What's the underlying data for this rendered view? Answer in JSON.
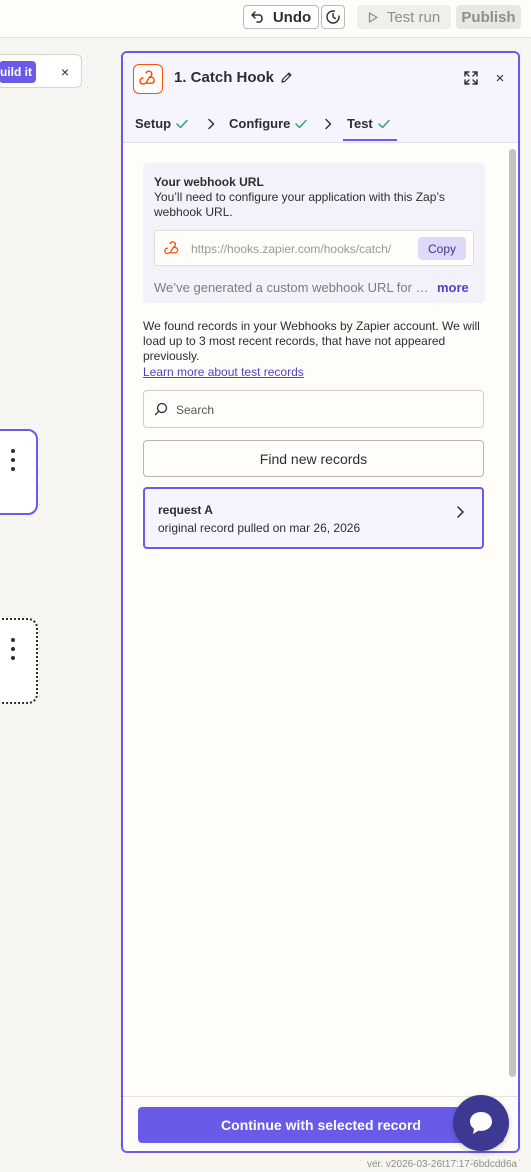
{
  "toolbar": {
    "undo_label": "Undo",
    "test_run_label": "Test run",
    "publish_label": "Publish"
  },
  "canvas": {
    "build_it_label": "Build it",
    "close_symbol": "×"
  },
  "panel": {
    "title": "1. Catch Hook",
    "close_symbol": "×",
    "steps": [
      {
        "label": "Setup"
      },
      {
        "label": "Configure"
      },
      {
        "label": "Test"
      }
    ],
    "webhook": {
      "title": "Your webhook URL",
      "description": "You’ll need to configure your application with this Zap’s webhook URL.",
      "url": "https://hooks.zapier.com/hooks/catch/",
      "copy_label": "Copy",
      "note": "We’ve generated a custom webhook URL for you to send requests to.",
      "more_label": "more"
    },
    "found_text": "We found records in your Webhooks by Zapier account. We will load up to 3 most recent records, that have not appeared previously.",
    "learn_link": "Learn more about test records",
    "search": {
      "placeholder": "Search"
    },
    "find_button": "Find new records",
    "records": [
      {
        "title": "request A",
        "subtitle": "original record pulled on mar 26, 2026"
      }
    ],
    "continue_button": "Continue with selected record"
  },
  "footer": {
    "version": "ver. v2026-03-26t17:17-6bdcdd6a"
  },
  "colors": {
    "accent": "#695be8",
    "brand_orange": "#ff4f00",
    "check_green": "#2fa56b",
    "link": "#4f43c7"
  },
  "icons": [
    "undo-icon",
    "history-icon",
    "play-icon",
    "webhook-icon",
    "pencil-icon",
    "expand-icon",
    "check-icon",
    "chevron-right-icon",
    "search-icon",
    "chat-icon",
    "kebab-icon"
  ]
}
